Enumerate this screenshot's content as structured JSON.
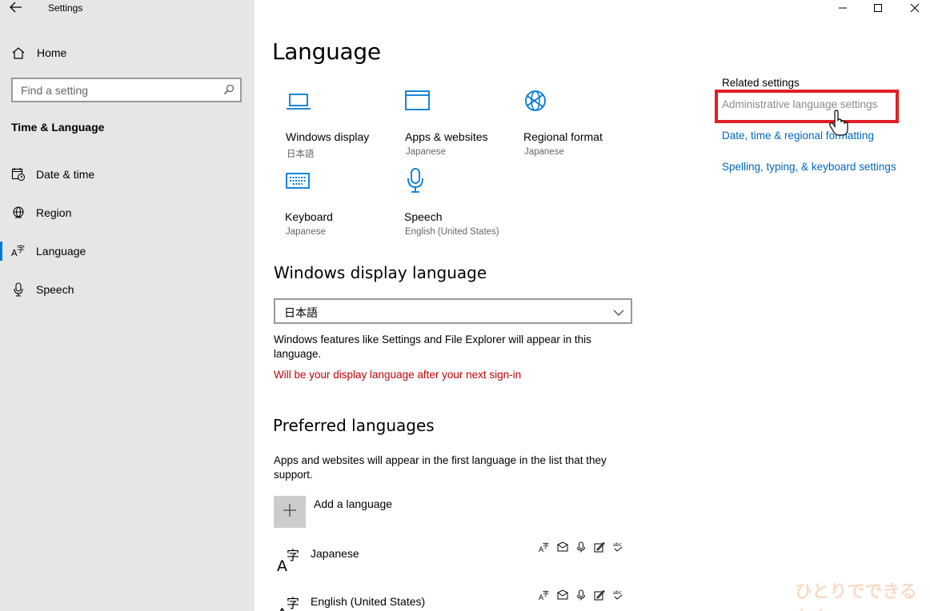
{
  "window": {
    "title": "Settings"
  },
  "sidebar": {
    "home_label": "Home",
    "search_placeholder": "Find a setting",
    "section_title": "Time & Language",
    "items": [
      {
        "label": "Date & time",
        "icon": "calendar-clock-icon"
      },
      {
        "label": "Region",
        "icon": "globe-icon"
      },
      {
        "label": "Language",
        "icon": "language-icon",
        "active": true
      },
      {
        "label": "Speech",
        "icon": "microphone-icon"
      }
    ]
  },
  "main": {
    "title": "Language",
    "tiles": [
      {
        "name": "Windows display",
        "sub": "日本語",
        "icon": "laptop-icon"
      },
      {
        "name": "Apps & websites",
        "sub": "Japanese",
        "icon": "window-icon"
      },
      {
        "name": "Regional format",
        "sub": "Japanese",
        "icon": "globe-format-icon"
      },
      {
        "name": "Keyboard",
        "sub": "Japanese",
        "icon": "keyboard-icon"
      },
      {
        "name": "Speech",
        "sub": "English (United States)",
        "icon": "microphone-icon"
      }
    ],
    "display_language": {
      "heading": "Windows display language",
      "selected": "日本語",
      "description": "Windows features like Settings and File Explorer will appear in this language.",
      "notice": "Will be your display language after your next sign-in"
    },
    "preferred": {
      "heading": "Preferred languages",
      "description": "Apps and websites will appear in the first language in the list that they support.",
      "add_label": "Add a language",
      "languages": [
        {
          "name": "Japanese"
        },
        {
          "name": "English (United States)"
        }
      ]
    }
  },
  "related": {
    "heading": "Related settings",
    "links": [
      "Administrative language settings",
      "Date, time & regional formatting",
      "Spelling, typing, & keyboard settings"
    ]
  },
  "accent_color": "#0078d7",
  "link_color": "#0067c0",
  "warning_color": "#c50000",
  "highlight_color": "#e01f26"
}
